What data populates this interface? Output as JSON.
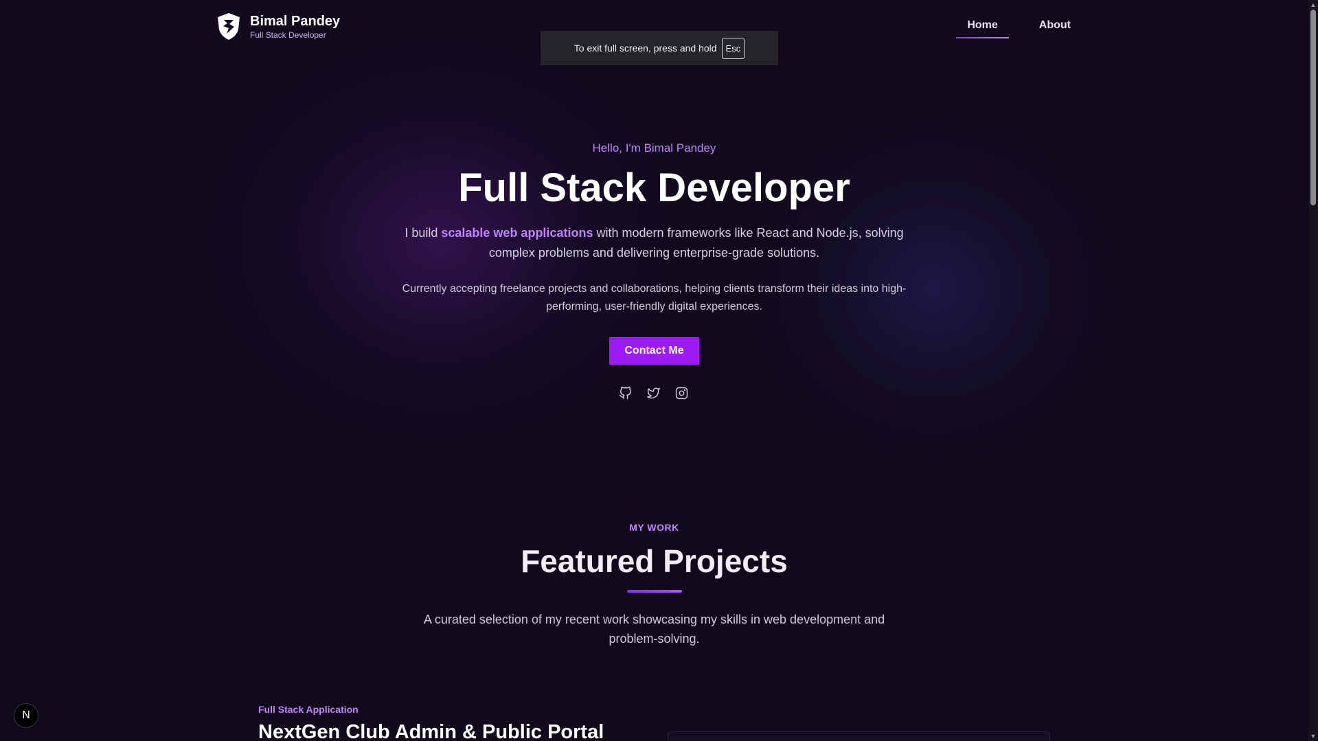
{
  "brand": {
    "name": "Bimal Pandey",
    "subtitle": "Full Stack Developer",
    "logo_icon": "shield-logo-icon"
  },
  "nav": {
    "items": [
      {
        "label": "Home",
        "active": true
      },
      {
        "label": "About",
        "active": false
      }
    ]
  },
  "fullscreen_toast": {
    "text": "To exit full screen, press and hold",
    "key": "Esc"
  },
  "hero": {
    "greeting": "Hello, I'm Bimal Pandey",
    "title": "Full Stack Developer",
    "desc_before": "I build ",
    "desc_highlight": "scalable web applications",
    "desc_after": " with modern frameworks like React and Node.js, solving complex problems and delivering enterprise-grade solutions.",
    "note": "Currently accepting freelance projects and collaborations, helping clients transform their ideas into high-performing, user-friendly digital experiences.",
    "cta_label": "Contact Me",
    "social_icons": [
      "github-icon",
      "twitter-icon",
      "instagram-icon"
    ]
  },
  "projects": {
    "eyebrow": "MY WORK",
    "title": "Featured Projects",
    "description": "A curated selection of my recent work showcasing my skills in web development and problem-solving.",
    "first": {
      "category": "Full Stack Application",
      "title": "NextGen Club Admin & Public Portal"
    }
  },
  "dev_badge": {
    "label": "N"
  },
  "colors": {
    "accent": "#c084fc",
    "button": "#9d1cf5",
    "background": "#110a1c"
  }
}
